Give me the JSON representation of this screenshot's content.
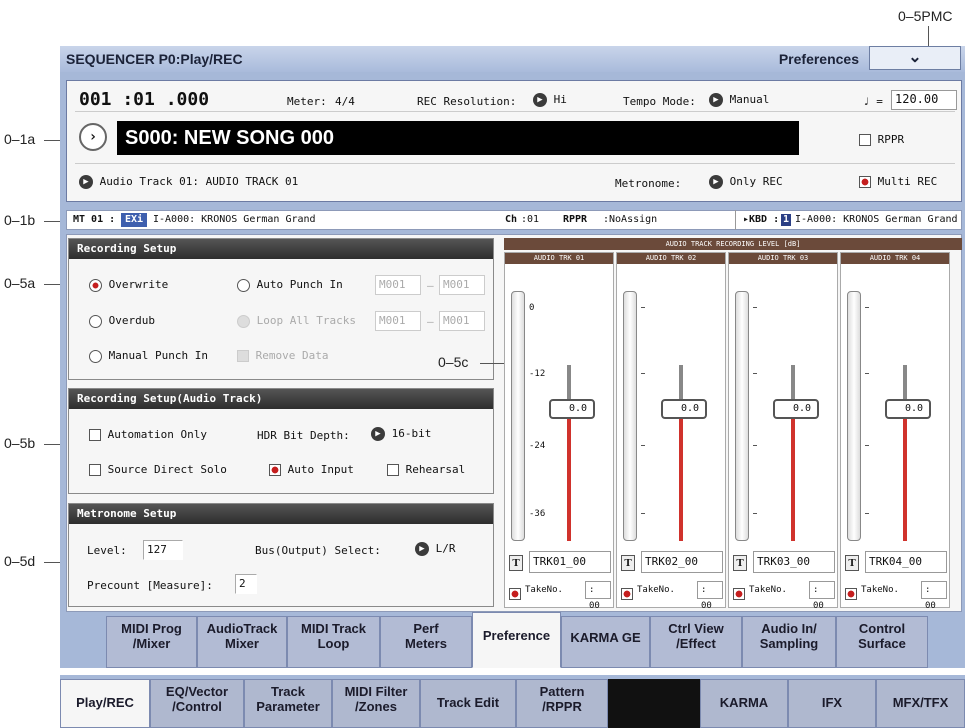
{
  "callouts": {
    "top_right": "0–5PMC",
    "c01a": "0–1a",
    "c01b": "0–1b",
    "c05a": "0–5a",
    "c05b": "0–5b",
    "c05c": "0–5c",
    "c05d": "0–5d"
  },
  "header": {
    "title": "SEQUENCER P0:Play/REC",
    "preferences_label": "Preferences",
    "menu_arrow": "⌄"
  },
  "top": {
    "location": "001 :01 .000",
    "meter_label": "Meter:",
    "meter_value": "4/4",
    "rec_res_label": "REC Resolution:",
    "rec_res_value": "Hi",
    "tempo_mode_label": "Tempo Mode:",
    "tempo_mode_value": "Manual",
    "tempo_symbol": "♩ =",
    "tempo_value": "120.00",
    "song_name": "S000: NEW SONG 000",
    "rppr_label": "RPPR",
    "audio_track": "Audio Track 01: AUDIO TRACK 01",
    "metronome_label": "Metronome:",
    "metronome_value": "Only REC",
    "multi_rec_label": "Multi REC"
  },
  "track_info": {
    "mt": "MT 01 :",
    "exi": "EXi",
    "program": "I-A000: KRONOS German Grand",
    "ch_label": "Ch",
    "ch_value": ":01",
    "rppr_label": "RPPR",
    "rppr_value": ":NoAssign",
    "kbd_label": "▸KBD :",
    "kbd_badge": "1",
    "kbd_program": "I-A000: KRONOS German Grand"
  },
  "recording_setup": {
    "title": "Recording Setup",
    "overwrite": "Overwrite",
    "auto_punch": "Auto Punch In",
    "overdub": "Overdub",
    "loop_all": "Loop All Tracks",
    "manual_punch": "Manual Punch In",
    "remove_data": "Remove Data",
    "m1": "M001",
    "m2": "M001",
    "m3": "M001",
    "m4": "M001",
    "dash": "–"
  },
  "recording_audio": {
    "title": "Recording Setup(Audio Track)",
    "automation_only": "Automation Only",
    "hdr_label": "HDR Bit Depth:",
    "hdr_value": "16-bit",
    "source_direct": "Source Direct Solo",
    "auto_input": "Auto Input",
    "rehearsal": "Rehearsal"
  },
  "metronome_setup": {
    "title": "Metronome Setup",
    "level_label": "Level:",
    "level_value": "127",
    "bus_label": "Bus(Output) Select:",
    "bus_value": "L/R",
    "precount_label": "Precount [Measure]:",
    "precount_value": "2"
  },
  "levels": {
    "title": "AUDIO TRACK RECORDING LEVEL [dB]",
    "scale": [
      "0",
      "-12",
      "-24",
      "-36"
    ],
    "tracks": [
      {
        "name": "AUDIO TRK 01",
        "value": "0.0",
        "file": "TRK01_00",
        "take_label": "TakeNo.",
        "take_value": ": 00"
      },
      {
        "name": "AUDIO TRK 02",
        "value": "0.0",
        "file": "TRK02_00",
        "take_label": "TakeNo.",
        "take_value": ": 00"
      },
      {
        "name": "AUDIO TRK 03",
        "value": "0.0",
        "file": "TRK03_00",
        "take_label": "TakeNo.",
        "take_value": ": 00"
      },
      {
        "name": "AUDIO TRK 04",
        "value": "0.0",
        "file": "TRK04_00",
        "take_label": "TakeNo.",
        "take_value": ": 00"
      }
    ],
    "t_btn": "T"
  },
  "tabs_top": [
    {
      "label": "MIDI Prog\n/Mixer"
    },
    {
      "label": "AudioTrack\nMixer"
    },
    {
      "label": "MIDI Track\nLoop"
    },
    {
      "label": "Perf\nMeters"
    },
    {
      "label": "Preference"
    },
    {
      "label": "KARMA GE"
    },
    {
      "label": "Ctrl View\n/Effect"
    },
    {
      "label": "Audio In/\nSampling"
    },
    {
      "label": "Control\nSurface"
    }
  ],
  "tabs_bottom": [
    {
      "label": "Play/REC"
    },
    {
      "label": "EQ/Vector\n/Control"
    },
    {
      "label": "Track\nParameter"
    },
    {
      "label": "MIDI Filter\n/Zones"
    },
    {
      "label": "Track Edit"
    },
    {
      "label": "Pattern\n/RPPR"
    },
    {
      "label": ""
    },
    {
      "label": "KARMA"
    },
    {
      "label": "IFX"
    },
    {
      "label": "MFX/TFX"
    }
  ]
}
